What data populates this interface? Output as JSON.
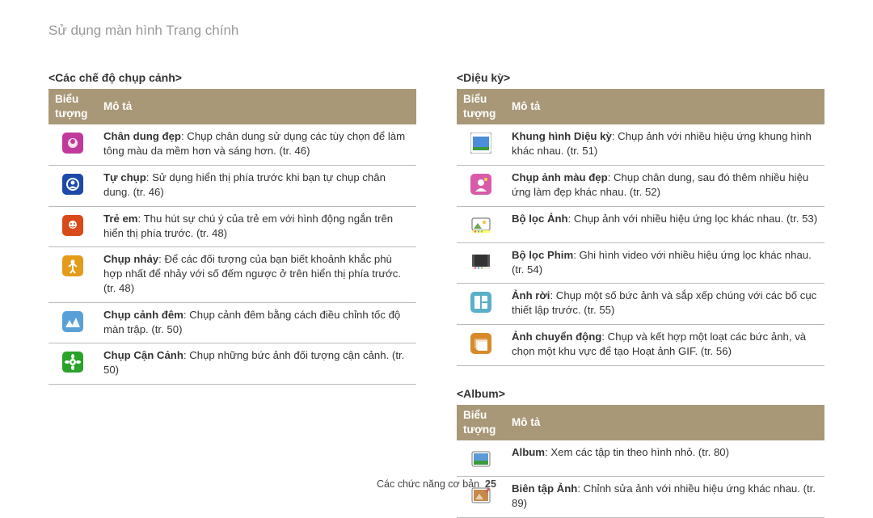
{
  "page_title": "Sử dụng màn hình Trang chính",
  "footer_text": "Các chức năng cơ bản",
  "page_number": "25",
  "header_icon": "Biểu tượng",
  "header_desc": "Mô tả",
  "sections": {
    "shoot": {
      "title": "<Các chế độ chụp cảnh>",
      "rows": [
        {
          "name": "Chân dung đẹp",
          "desc": ": Chụp chân dung sử dụng các tùy chọn để làm tông màu da mềm hơn và sáng hơn. (tr. 46)"
        },
        {
          "name": "Tự chụp",
          "desc": ": Sử dụng hiển thị phía trước khi bạn tự chụp chân dung. (tr. 46)"
        },
        {
          "name": "Trẻ em",
          "desc": ": Thu hút sự chú ý của trẻ em với hình động ngắn trên hiển thị phía trước. (tr. 48)"
        },
        {
          "name": "Chụp nhảy",
          "desc": ": Để các đối tượng của bạn biết khoảnh khắc phù hợp nhất để nhảy với số đếm ngược ở trên hiển thị phía trước. (tr. 48)"
        },
        {
          "name": "Chụp cảnh đêm",
          "desc": ": Chụp cảnh đêm bằng cách điều chỉnh tốc độ màn trập. (tr. 50)"
        },
        {
          "name": "Chụp Cận Cảnh",
          "desc": ": Chụp những bức ảnh đối tượng cận cảnh. (tr. 50)"
        }
      ]
    },
    "magic": {
      "title": "<Diệu kỳ>",
      "rows": [
        {
          "name": "Khung hình Diệu kỳ",
          "desc": ": Chụp ảnh với nhiều hiệu ứng khung hình khác nhau. (tr. 51)"
        },
        {
          "name": "Chụp ảnh màu đẹp",
          "desc": ": Chụp chân dung, sau đó thêm nhiều hiệu ứng làm đẹp khác nhau. (tr. 52)"
        },
        {
          "name": "Bộ lọc Ảnh",
          "desc": ": Chụp ảnh với nhiều hiệu ứng lọc khác nhau. (tr. 53)"
        },
        {
          "name": "Bộ lọc Phim",
          "desc": ": Ghi hình video với nhiều hiệu ứng lọc khác nhau. (tr. 54)"
        },
        {
          "name": "Ảnh rời",
          "desc": ": Chụp một số bức ảnh và sắp xếp chúng với các bố cục thiết lập trước. (tr. 55)"
        },
        {
          "name": "Ảnh chuyển động",
          "desc": ": Chụp và kết hợp một loạt các bức ảnh, và chọn một khu vực để tạo Hoạt ảnh GIF. (tr. 56)"
        }
      ]
    },
    "album": {
      "title": "<Album>",
      "rows": [
        {
          "name": "Album",
          "desc": ": Xem các tập tin theo hình nhỏ. (tr. 80)"
        },
        {
          "name": "Biên tập Ảnh",
          "desc": ": Chỉnh sửa ảnh với nhiều hiệu ứng khác nhau. (tr. 89)"
        }
      ]
    }
  }
}
